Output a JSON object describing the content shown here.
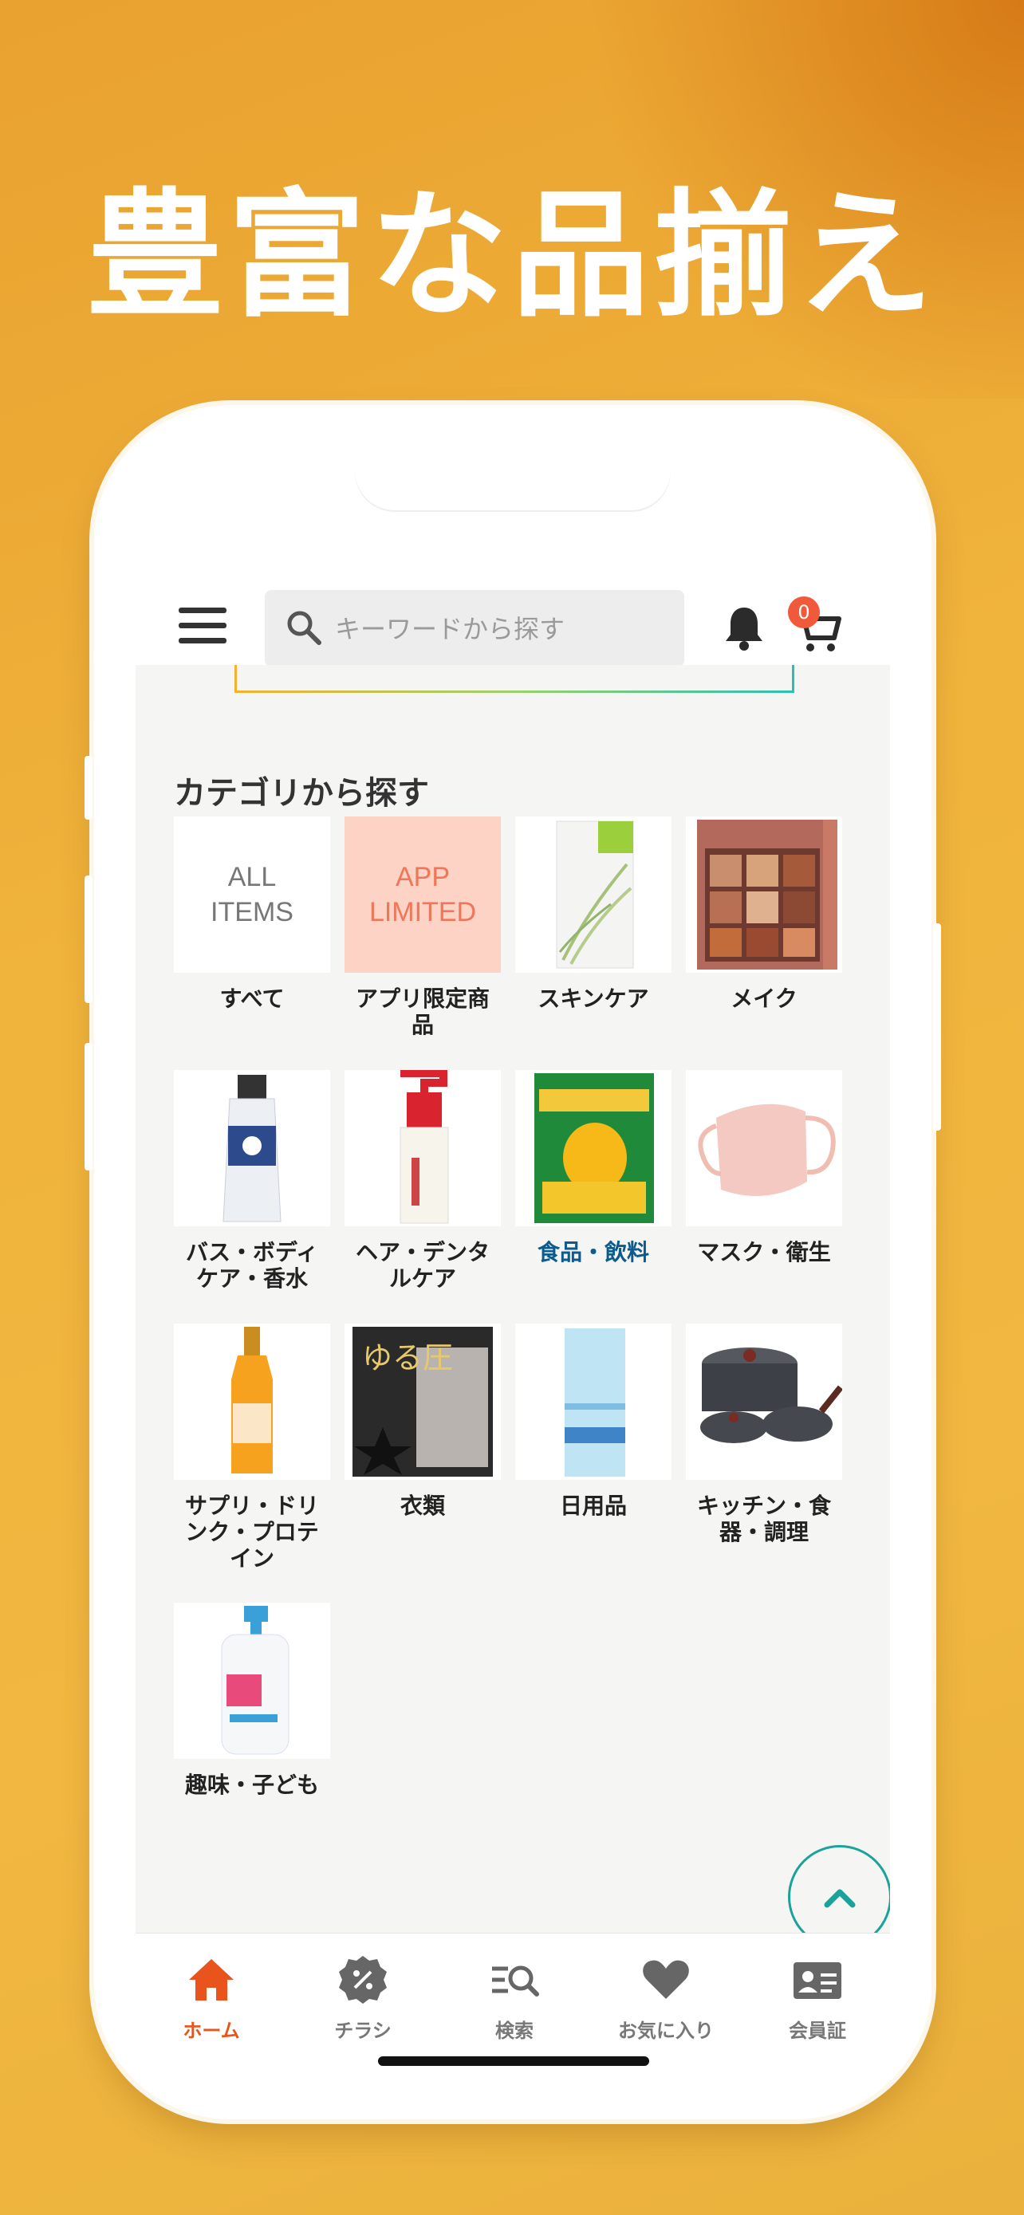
{
  "headline": "豊富な品揃え",
  "colors": {
    "accent": "#e8541c",
    "background": "#f0b43c",
    "active_category": "#0d5b8c",
    "scroll_top": "#1aa39a",
    "badge": "#f05a3a"
  },
  "header": {
    "search_placeholder": "キーワードから探す",
    "cart_count": "0"
  },
  "categories_title": "カテゴリから探す",
  "categories": [
    {
      "label": "すべて",
      "thumb_text": "ALL\nITEMS",
      "icon": "all-items-thumb"
    },
    {
      "label": "アプリ限定商品",
      "thumb_text": "APP\nLIMITED",
      "icon": "app-limited-thumb"
    },
    {
      "label": "スキンケア",
      "icon": "skincare-bottle"
    },
    {
      "label": "メイク",
      "icon": "eyeshadow-palette"
    },
    {
      "label": "バス・ボディケア・香水",
      "icon": "hand-cream-tube"
    },
    {
      "label": "ヘア・デンタルケア",
      "icon": "pump-bottle"
    },
    {
      "label": "食品・飲料",
      "icon": "dried-mango-pack",
      "active": true
    },
    {
      "label": "マスク・衛生",
      "icon": "face-mask"
    },
    {
      "label": "サプリ・ドリンク・プロテイン",
      "icon": "drink-bottle"
    },
    {
      "label": "衣類",
      "thumb_text": "ゆる圧",
      "icon": "clothing-pack"
    },
    {
      "label": "日用品",
      "icon": "towel-pack"
    },
    {
      "label": "キッチン・食器・調理",
      "icon": "cookware-set"
    },
    {
      "label": "趣味・子ども",
      "icon": "baby-soap-bottle"
    }
  ],
  "tabs": [
    {
      "label": "ホーム",
      "icon": "home-icon",
      "active": true
    },
    {
      "label": "チラシ",
      "icon": "flyer-percent-icon"
    },
    {
      "label": "検索",
      "icon": "search-list-icon"
    },
    {
      "label": "お気に入り",
      "icon": "heart-icon"
    },
    {
      "label": "会員証",
      "icon": "member-card-icon"
    }
  ]
}
